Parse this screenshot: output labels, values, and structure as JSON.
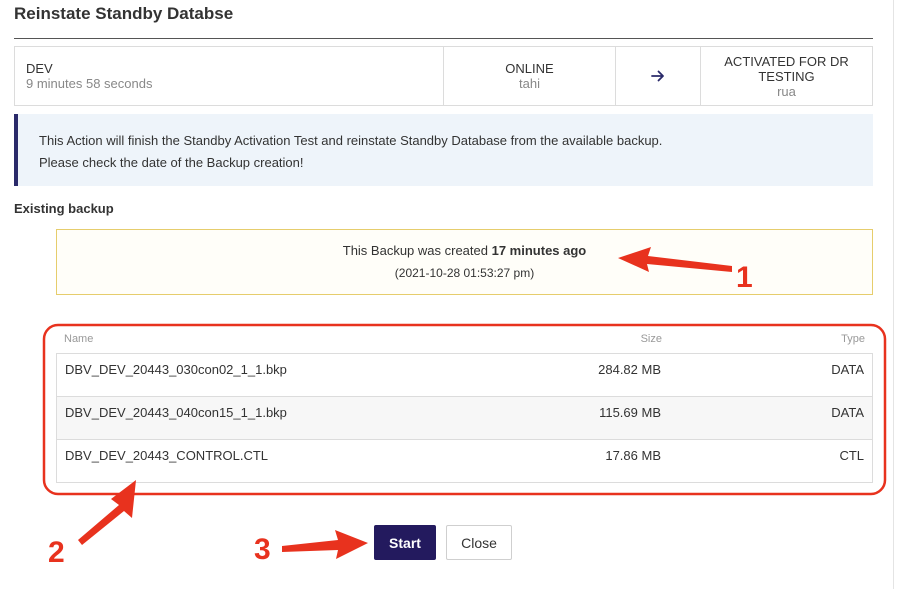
{
  "dialog": {
    "title": "Reinstate Standby Databse"
  },
  "status": {
    "source": {
      "name": "DEV",
      "detail": "9 minutes 58 seconds"
    },
    "state": {
      "label": "ONLINE",
      "host": "tahi"
    },
    "arrow_icon": "arrow-right-icon",
    "target": {
      "label": "ACTIVATED FOR DR TESTING",
      "host": "rua"
    }
  },
  "info": {
    "line1": "This Action will finish the Standby Activation Test and reinstate Standby Database from the available backup.",
    "line2": "Please check the date of the Backup creation!"
  },
  "backup_section": {
    "label": "Existing backup",
    "created_prefix": "This Backup was created ",
    "created_age": "17 minutes ago",
    "created_timestamp": "(2021-10-28 01:53:27 pm)"
  },
  "files_table": {
    "headers": {
      "name": "Name",
      "size": "Size",
      "type": "Type"
    },
    "rows": [
      {
        "name": "DBV_DEV_20443_030con02_1_1.bkp",
        "size": "284.82 MB",
        "type": "DATA"
      },
      {
        "name": "DBV_DEV_20443_040con15_1_1.bkp",
        "size": "115.69 MB",
        "type": "DATA"
      },
      {
        "name": "DBV_DEV_20443_CONTROL.CTL",
        "size": "17.86 MB",
        "type": "CTL"
      }
    ]
  },
  "actions": {
    "start_label": "Start",
    "close_label": "Close"
  },
  "annotations": {
    "marker_1": "1",
    "marker_2": "2",
    "marker_3": "3",
    "color": "#e8321e"
  },
  "colors": {
    "primary_button": "#231a5e",
    "info_accent": "#2a2a6a",
    "info_background": "#eef4fa",
    "backup_border": "#e6cd6c"
  }
}
